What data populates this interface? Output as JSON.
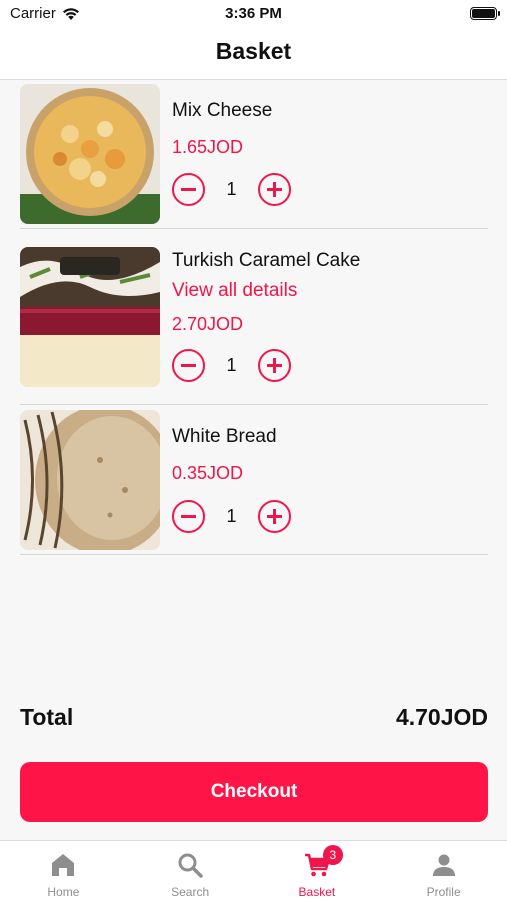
{
  "status_bar": {
    "carrier": "Carrier",
    "time": "3:36 PM",
    "icons": [
      "wifi-icon",
      "battery-icon"
    ]
  },
  "header": {
    "title": "Basket"
  },
  "items": [
    {
      "name": "Mix Cheese",
      "link": "",
      "price": "1.65JOD",
      "quantity": "1",
      "image": "pizza"
    },
    {
      "name": "Turkish Caramel Cake",
      "link": "View all details",
      "price": "2.70JOD",
      "quantity": "1",
      "image": "cake"
    },
    {
      "name": "White Bread",
      "link": "",
      "price": "0.35JOD",
      "quantity": "1",
      "image": "bread"
    }
  ],
  "total": {
    "label": "Total",
    "value": "4.70JOD"
  },
  "checkout": {
    "label": "Checkout"
  },
  "tabs": [
    {
      "label": "Home",
      "icon": "home-icon",
      "active": false
    },
    {
      "label": "Search",
      "icon": "search-icon",
      "active": false
    },
    {
      "label": "Basket",
      "icon": "cart-icon",
      "active": true,
      "badge": "3"
    },
    {
      "label": "Profile",
      "icon": "profile-icon",
      "active": false
    }
  ],
  "colors": {
    "accent": "#f0154a",
    "button": "#ff1447",
    "background": "#f7f7f7",
    "inactive": "#8e8e8e"
  }
}
